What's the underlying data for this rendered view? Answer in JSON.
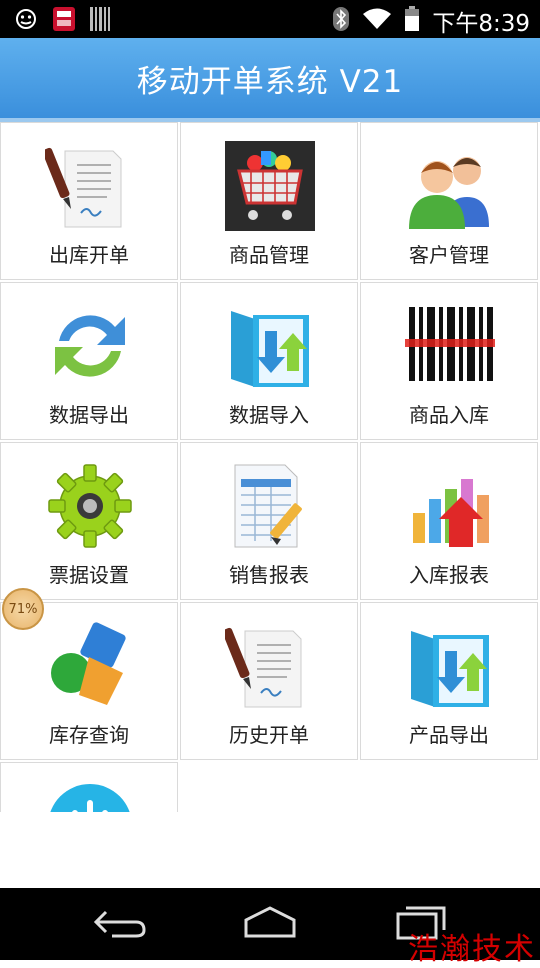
{
  "status_bar": {
    "time": "下午8:39",
    "notification_icon": "notification-icon"
  },
  "title": "移动开单系统 V21",
  "menu": [
    {
      "label": "出库开单",
      "icon": "document-pen-icon"
    },
    {
      "label": "商品管理",
      "icon": "shopping-cart-icon"
    },
    {
      "label": "客户管理",
      "icon": "users-icon"
    },
    {
      "label": "数据导出",
      "icon": "refresh-icon"
    },
    {
      "label": "数据导入",
      "icon": "import-folder-icon"
    },
    {
      "label": "商品入库",
      "icon": "barcode-icon"
    },
    {
      "label": "票据设置",
      "icon": "gear-icon"
    },
    {
      "label": "销售报表",
      "icon": "spreadsheet-icon"
    },
    {
      "label": "入库报表",
      "icon": "bar-chart-icon"
    },
    {
      "label": "库存查询",
      "icon": "shapes-icon"
    },
    {
      "label": "历史开单",
      "icon": "document-pen-icon"
    },
    {
      "label": "产品导出",
      "icon": "export-folder-icon"
    },
    {
      "label": "",
      "icon": "power-icon"
    }
  ],
  "float_badge": "71%",
  "watermark": "浩瀚技术",
  "colors": {
    "title_bar": "#3a8fdc",
    "accent_red": "#d40000"
  }
}
